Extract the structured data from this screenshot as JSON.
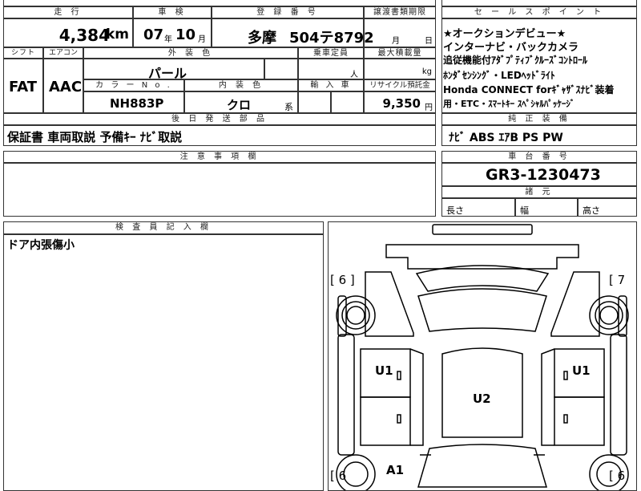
{
  "headers": {
    "mileage": "走 行",
    "inspection": "車 検",
    "registration": "登 録 番 号",
    "transfer_deadline": "譲渡書類期限",
    "sales_point": "セ ー ル ス ポ イ ン ト",
    "shift": "シフト",
    "aircon": "エアコン",
    "exterior_color": "外 装 色",
    "capacity": "乗車定員",
    "max_load": "最大積載量",
    "color_no": "カ ラ ー N o .",
    "interior_color": "内 装 色",
    "import": "輸 入 車",
    "recycle": "リサイクル預託金",
    "later_parts": "後 日 発 送 部 品",
    "genuine_equipment": "純 正 装 備",
    "notes": "注 意 事 項 欄",
    "chassis_no": "車 台 番 号",
    "dimensions": "諸 元",
    "inspector_notes": "検 査 員 記 入 欄"
  },
  "vehicle": {
    "mileage_value": "4,384",
    "mileage_unit": "km",
    "inspection_year": "07",
    "inspection_year_unit": "年",
    "inspection_month": "10",
    "inspection_month_unit": "月",
    "plate_region": "多摩",
    "plate_number": "504テ8792",
    "deadline_month_unit": "月",
    "deadline_day_unit": "日",
    "shift": "FAT",
    "aircon": "AAC",
    "exterior_color": "パール",
    "capacity_unit": "人",
    "max_load_unit": "kg",
    "color_no": "NH883P",
    "interior_color": "クロ",
    "interior_suffix": "系",
    "recycle_amount": "9,350",
    "recycle_unit": "円",
    "chassis_no": "GR3-1230473"
  },
  "sales_points": [
    "★オークションデビュー★",
    "インターナビ・バックカメラ",
    "追従機能付ｱﾀﾞﾌﾟﾃｨﾌﾞｸﾙｰｽﾞｺﾝﾄﾛｰﾙ",
    "ﾎﾝﾀﾞｾﾝｼﾝｸﾞ・LEDﾍｯﾄﾞﾗｲﾄ",
    "Honda CONNECT forｷﾞｬｻﾞｽﾅﾋﾞ装着",
    "用・ETC・ｽﾏｰﾄｷｰ ｽﾍﾟｼｬﾙﾊﾟｯｹｰｼﾞ"
  ],
  "later_parts_text": "保証書 車両取説 予備ｷｰ ﾅﾋﾞ取説",
  "genuine_equipment_text": "ﾅﾋﾞ ABS ｴｱB PS PW",
  "dimensions": {
    "length": "長さ",
    "width": "幅",
    "height": "高さ"
  },
  "inspector_text": "ドア内張傷小",
  "diagram": {
    "left_mark_top": "[ 6 ]",
    "right_mark_top": "[ 7",
    "left_mark_bottom": "[ 6",
    "right_mark_bottom": "[ 6",
    "door_left": "U1",
    "door_right": "U1",
    "roof": "U2",
    "bottom_left": "A1"
  }
}
